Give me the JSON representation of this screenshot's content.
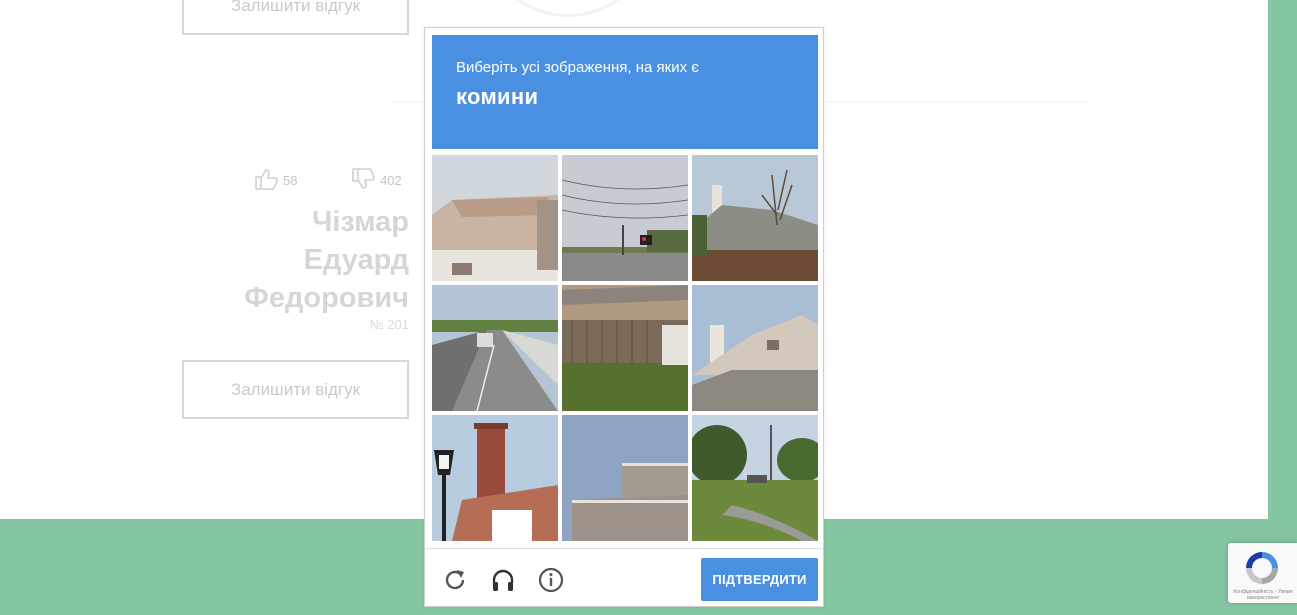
{
  "page": {
    "review_button_label": "Залишити відгук",
    "likes": "58",
    "dislikes": "402",
    "person_name_lines": [
      "Чізмар",
      "Едуард",
      "Федорович"
    ],
    "person_number": "№ 201"
  },
  "captcha": {
    "instruction": "Виберіть усі зображення, на яких є",
    "keyword": "комини",
    "tiles": [
      {
        "desc": "roof"
      },
      {
        "desc": "road with traffic light"
      },
      {
        "desc": "house with chimney"
      },
      {
        "desc": "bridge road"
      },
      {
        "desc": "fence"
      },
      {
        "desc": "house with chimney"
      },
      {
        "desc": "brick chimney with lamp"
      },
      {
        "desc": "roof edge"
      },
      {
        "desc": "park with trees"
      }
    ],
    "verify_label": "ПІДТВЕРДИТИ",
    "controls": [
      "reload-icon",
      "headphones-icon",
      "info-icon"
    ],
    "accent_color": "#4a90e2"
  },
  "recaptcha_badge": {
    "text": "Конфіденційність - Умови використання"
  },
  "colors": {
    "green": "#84c6a1",
    "blue": "#4a90e2"
  }
}
